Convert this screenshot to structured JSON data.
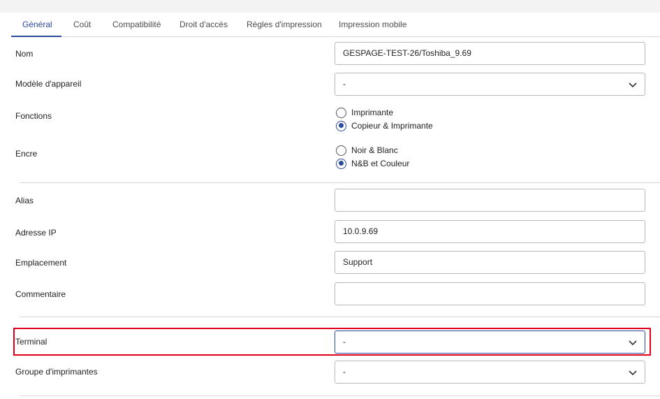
{
  "tabs": [
    {
      "label": "Général",
      "active": true
    },
    {
      "label": "Coût"
    },
    {
      "label": "Compatibilité"
    },
    {
      "label": "Droit d'accès"
    },
    {
      "label": "Règles d'impression"
    },
    {
      "label": "Impression mobile"
    }
  ],
  "form": {
    "nom": {
      "label": "Nom",
      "value": "GESPAGE-TEST-26/Toshiba_9.69"
    },
    "modele": {
      "label": "Modèle d'appareil",
      "value": "-"
    },
    "fonctions": {
      "label": "Fonctions",
      "options": [
        {
          "label": "Imprimante",
          "checked": false
        },
        {
          "label": "Copieur & Imprimante",
          "checked": true
        }
      ]
    },
    "encre": {
      "label": "Encre",
      "options": [
        {
          "label": "Noir & Blanc",
          "checked": false
        },
        {
          "label": "N&B et Couleur",
          "checked": true
        }
      ]
    },
    "alias": {
      "label": "Alias",
      "value": ""
    },
    "adresse_ip": {
      "label": "Adresse IP",
      "value": "10.0.9.69"
    },
    "emplacement": {
      "label": "Emplacement",
      "value": "Support"
    },
    "commentaire": {
      "label": "Commentaire",
      "value": ""
    },
    "terminal": {
      "label": "Terminal",
      "value": "-"
    },
    "groupe": {
      "label": "Groupe d'imprimantes",
      "value": "-"
    }
  },
  "colors": {
    "accent": "#2c4a9c",
    "highlight": "#e0001b",
    "border": "#b8b8b8"
  },
  "icons": {
    "dropdown": "chevron-down-icon"
  }
}
